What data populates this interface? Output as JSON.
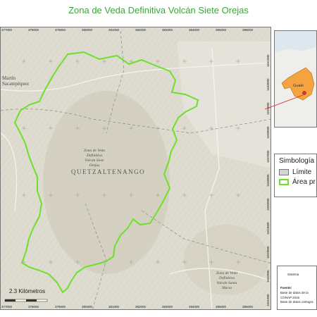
{
  "map": {
    "title": "Zona de Veda Definitiva Volcán Siete Orejas",
    "x_coords": [
      "377000",
      "378000",
      "379000",
      "380000",
      "381000",
      "382000",
      "383000",
      "384000",
      "385000",
      "386000"
    ],
    "x_coords_bottom": [
      "377000",
      "378000",
      "379000",
      "380000",
      "381000",
      "382000",
      "383000",
      "384000",
      "385000",
      "386000"
    ],
    "y_coords": [
      "1641000",
      "1640000",
      "1639000",
      "1638000",
      "1637000",
      "1636000",
      "1635000",
      "1634000",
      "1633000",
      "1632000",
      "1631000"
    ],
    "labels": {
      "san_martin_1": "Martín",
      "san_martin_2": "Sacatepéquez",
      "quetzaltenango": "QUETZALTENANGO",
      "zona_veda_main": [
        "Zona de Veda",
        "Definitiva",
        "Volcán Siete",
        "Orejas"
      ],
      "zona_veda_se": [
        "Zona de Veda",
        "Definitiva",
        "Volcán Santa",
        "María"
      ]
    },
    "scale_label": "2.3 Kilómetros",
    "colors": {
      "title": "#3aa63a",
      "boundary": "#6ee02a",
      "terrain": "#d9d6c9",
      "inset_land": "#f4a340"
    }
  },
  "legend": {
    "title": "Simbología",
    "items": [
      {
        "label": "Límite",
        "swatch": "gray"
      },
      {
        "label": "Área pr",
        "swatch": "green"
      }
    ]
  },
  "inset": {
    "labels": [
      "Guate"
    ]
  },
  "credits": {
    "heading": "Sistema",
    "source_label": "Fuente:",
    "lines": [
      "Base de datos de la",
      "CONAP 2016",
      "Base de datos cartogra"
    ]
  }
}
